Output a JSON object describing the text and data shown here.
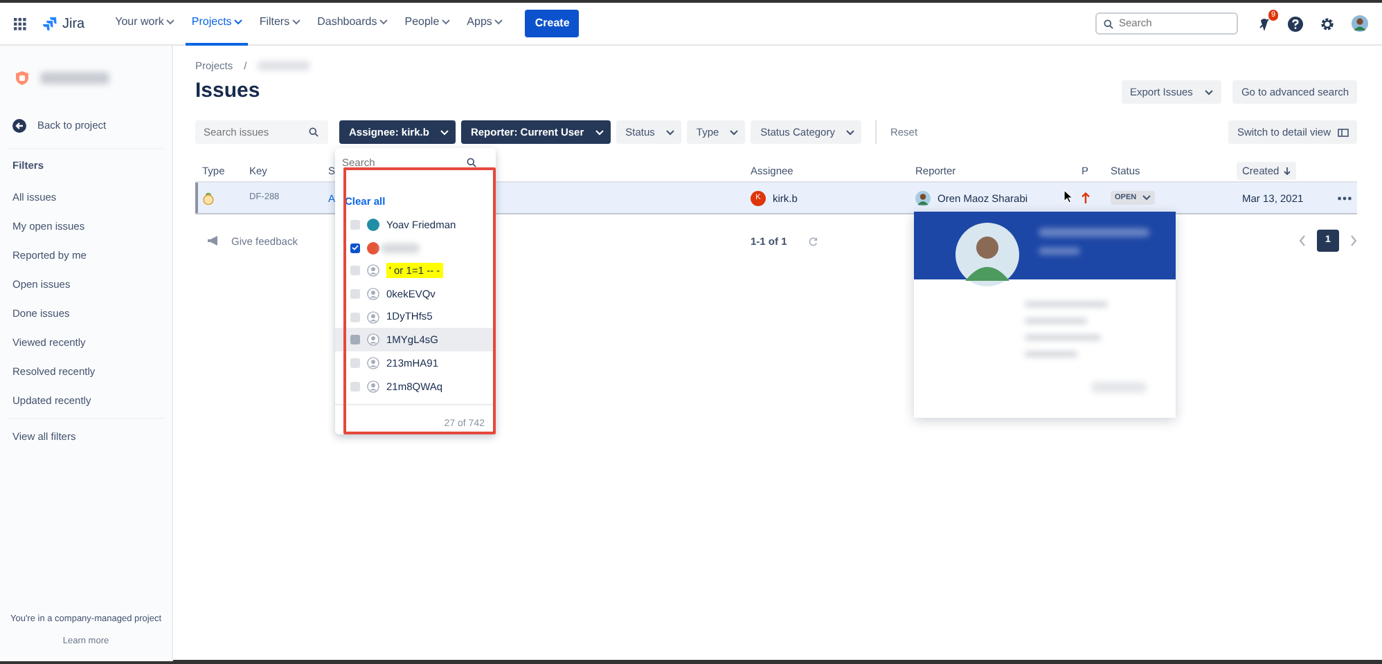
{
  "top_nav": {
    "items": [
      {
        "label": "Your work",
        "selected": false
      },
      {
        "label": "Projects",
        "selected": true
      },
      {
        "label": "Filters",
        "selected": false
      },
      {
        "label": "Dashboards",
        "selected": false
      },
      {
        "label": "People",
        "selected": false
      },
      {
        "label": "Apps",
        "selected": false
      }
    ],
    "logo": "Jira",
    "create": "Create",
    "search": {
      "placeholder": "Search"
    },
    "notification_count": "9"
  },
  "sidebar": {
    "back": "Back to project",
    "section": "Filters",
    "items": [
      "All issues",
      "My open issues",
      "Reported by me",
      "Open issues",
      "Done issues",
      "Viewed recently",
      "Resolved recently",
      "Updated recently"
    ],
    "view_all": "View all filters",
    "footer": "You're in a company-managed project",
    "learn_more": "Learn more"
  },
  "page": {
    "breadcrumb": "Projects",
    "breadcrumb_separator": "/",
    "title": "Issues",
    "actions": [
      {
        "label": "Export Issues",
        "dropdown": true
      },
      {
        "label": "Go to advanced search",
        "dropdown": false
      }
    ]
  },
  "filters": {
    "search_placeholder": "Search issues",
    "chips": [
      {
        "label": "Assignee: kirk.b",
        "active": true
      },
      {
        "label": "Reporter: Current User",
        "active": true
      },
      {
        "label": "Status",
        "active": false
      },
      {
        "label": "Type",
        "active": false
      },
      {
        "label": "Status Category",
        "active": false
      }
    ],
    "reset": "Reset",
    "detail_view": "Switch to detail view"
  },
  "table": {
    "columns": [
      {
        "label": "Type",
        "sorted": false
      },
      {
        "label": "Key",
        "sorted": false
      },
      {
        "label": "S",
        "sorted": false
      },
      {
        "label": "Assignee",
        "sorted": false
      },
      {
        "label": "Reporter",
        "sorted": false
      },
      {
        "label": "P",
        "sorted": false
      },
      {
        "label": "Status",
        "sorted": false
      },
      {
        "label": "Created",
        "sorted": true
      }
    ],
    "rows": [
      {
        "key": "DF-288",
        "summary": "A",
        "assignee_initial": "K",
        "assignee": "kirk.b",
        "reporter": "Oren Maoz Sharabi",
        "status": "OPEN",
        "created": "Mar 13, 2021",
        "selected": true
      }
    ]
  },
  "feedback": "Give feedback",
  "pagination": {
    "range": "1-1 of 1",
    "pages": [
      {
        "label": "1",
        "selected": true
      }
    ]
  },
  "assignee_dropdown": {
    "placeholder": "Search",
    "clear": "Clear all",
    "count": "27 of 742",
    "options": [
      {
        "label": "Yoav Friedman",
        "color": "#1f8ea6",
        "checked": false,
        "hovered": false,
        "highlighted": false
      },
      {
        "color": "#e5553a",
        "checked": true,
        "hovered": false,
        "highlighted": false
      },
      {
        "label": "' or 1=1 -- -",
        "checked": false,
        "hovered": false,
        "highlighted": true
      },
      {
        "label": "0kekEVQv",
        "checked": false,
        "hovered": false,
        "highlighted": false
      },
      {
        "label": "1DyTHfs5",
        "checked": false,
        "hovered": false,
        "highlighted": false
      },
      {
        "label": "1MYgL4sG",
        "checked": false,
        "hovered": true,
        "highlighted": false
      },
      {
        "label": "213mHA91",
        "checked": false,
        "hovered": false,
        "highlighted": false
      },
      {
        "label": "21m8QWAq",
        "checked": false,
        "hovered": false,
        "highlighted": false
      }
    ]
  }
}
